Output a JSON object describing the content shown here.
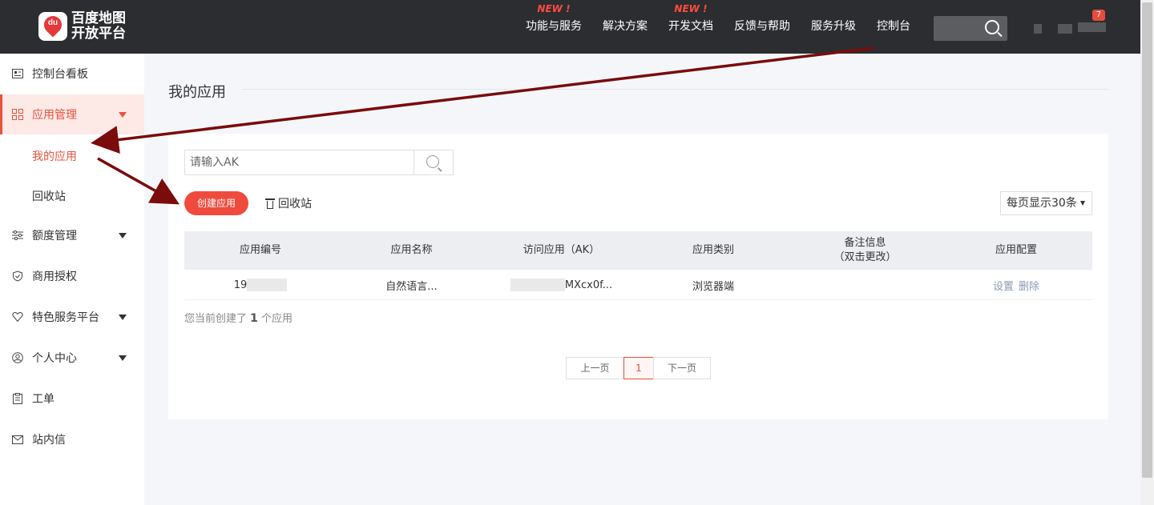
{
  "header": {
    "logo_text": "百度地图开放平台",
    "nav": [
      {
        "label": "功能与服务",
        "new": "NEW !"
      },
      {
        "label": "解决方案",
        "new": ""
      },
      {
        "label": "开发文档",
        "new": "NEW !"
      },
      {
        "label": "反馈与帮助",
        "new": ""
      },
      {
        "label": "服务升级",
        "new": ""
      },
      {
        "label": "控制台",
        "new": ""
      }
    ],
    "notification_count": "7"
  },
  "sidebar": {
    "items": [
      {
        "label": "控制台看板",
        "icon": "dashboard-icon"
      },
      {
        "label": "应用管理",
        "icon": "grid-icon"
      },
      {
        "label": "额度管理",
        "icon": "sliders-icon"
      },
      {
        "label": "商用授权",
        "icon": "shield-icon"
      },
      {
        "label": "特色服务平台",
        "icon": "heart-icon"
      },
      {
        "label": "个人中心",
        "icon": "user-icon"
      },
      {
        "label": "工单",
        "icon": "clipboard-icon"
      },
      {
        "label": "站内信",
        "icon": "mail-icon"
      }
    ],
    "subitems": [
      {
        "label": "我的应用"
      },
      {
        "label": "回收站"
      }
    ]
  },
  "main": {
    "page_title": "我的应用",
    "search_placeholder": "请输入AK",
    "create_button": "创建应用",
    "recycle_link": "回收站",
    "page_size": "每页显示30条",
    "table": {
      "headers": [
        "应用编号",
        "应用名称",
        "访问应用（AK）",
        "应用类别",
        "备注信息",
        "（双击更改）",
        "应用配置"
      ],
      "row": {
        "id": "19",
        "name": "自然语言...",
        "ak": "MXcx0f...",
        "category": "浏览器端",
        "remark": "",
        "op_settings": "设置",
        "op_delete": "删除"
      }
    },
    "summary": {
      "prefix": "您当前创建了",
      "count": "1",
      "suffix": "个应用"
    },
    "pagination": {
      "prev": "上一页",
      "current": "1",
      "next": "下一页"
    }
  },
  "colors": {
    "accent": "#ef4b3c",
    "header_bg": "#2b2d30",
    "arrow": "#7a0c0c"
  }
}
